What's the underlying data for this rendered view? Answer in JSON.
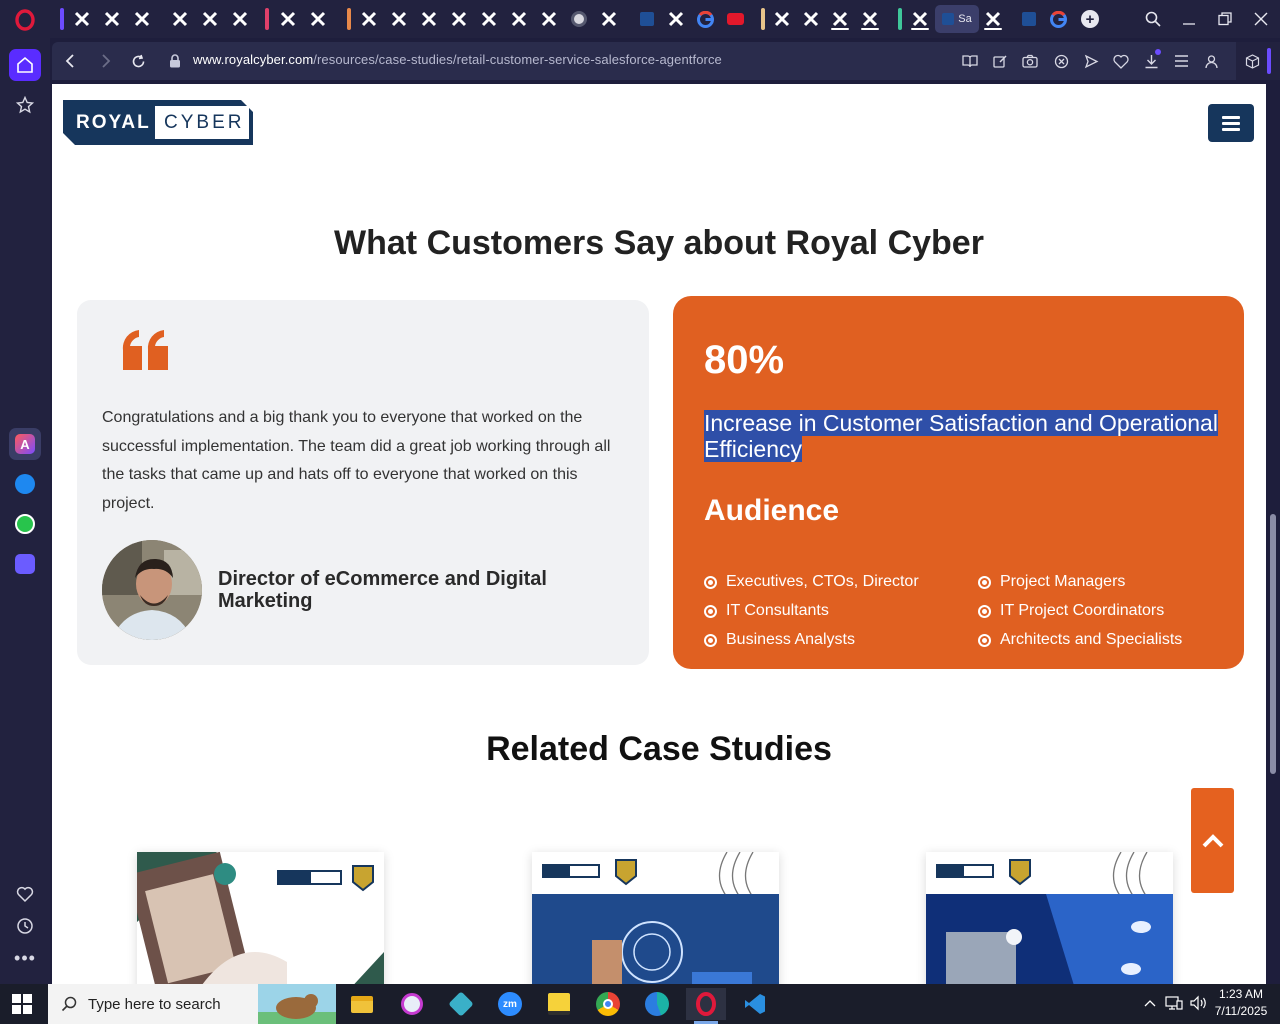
{
  "browser": {
    "address": {
      "host": "www.royalcyber.com",
      "path": "/resources/case-studies/retail-customer-service-salesforce-agentforce"
    },
    "active_tab_label": "Sa"
  },
  "page": {
    "logo": {
      "word1": "ROYAL",
      "word2": "CYBER"
    },
    "section_title": "What Customers Say about Royal Cyber",
    "testimonial": {
      "quote": "Congratulations and a big thank you to everyone that worked on the successful implementation. The team did a great job working through all the tasks that came up and hats off to everyone that worked on this project.",
      "author": "Director of eCommerce and Digital Marketing"
    },
    "stats": {
      "value": "80%",
      "description": "Increase in Customer Satisfaction and Operational Efficiency",
      "audience_title": "Audience",
      "audience": [
        "Executives, CTOs, Director",
        "Project Managers",
        "IT Consultants",
        "IT Project Coordinators",
        "Business Analysts",
        "Architects and Specialists"
      ]
    },
    "related_title": "Related Case Studies"
  },
  "taskbar": {
    "search_placeholder": "Type here to search",
    "time": "1:23 AM",
    "date": "7/11/2025"
  },
  "colors": {
    "accent_orange": "#e06021",
    "navy": "#16365c",
    "browser_chrome": "#22223f"
  }
}
